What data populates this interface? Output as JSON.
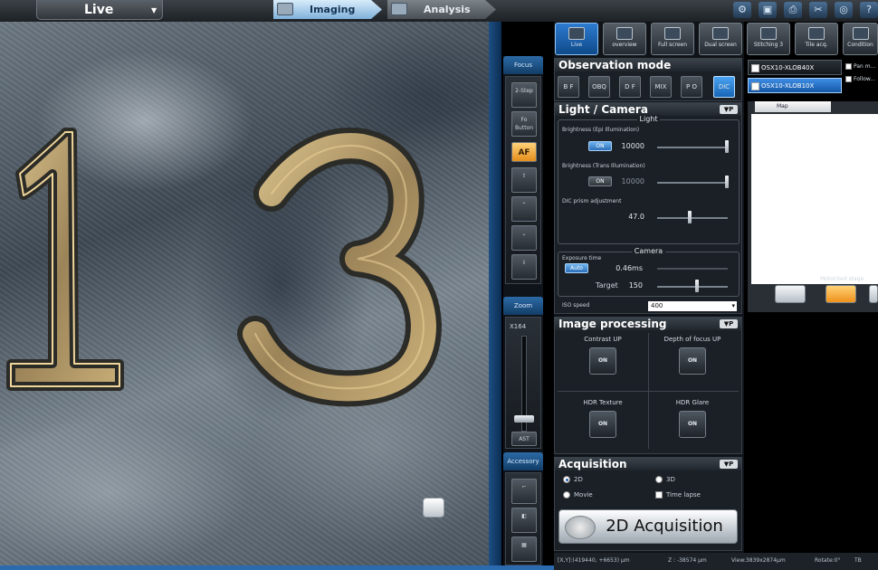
{
  "topbar": {
    "live_label": "Live",
    "tabs": [
      {
        "label": "Imaging"
      },
      {
        "label": "Analysis"
      }
    ],
    "icons": [
      "settings-icon",
      "save-icon",
      "print-icon",
      "tools-icon",
      "options-icon",
      "help-icon"
    ]
  },
  "live_image": {
    "digits": [
      "1",
      "3"
    ]
  },
  "focus_column": {
    "focus_label": "Focus",
    "buttons": [
      "2-Step",
      "Fo Button",
      "AF"
    ],
    "zoom_label": "Zoom",
    "zoom_value": "X164",
    "zoom_button": "AST",
    "accessory_label": "Accessory"
  },
  "toolbar": {
    "buttons": [
      {
        "label": "Live"
      },
      {
        "label": "overview"
      },
      {
        "label": "Full screen"
      },
      {
        "label": "Dual screen"
      },
      {
        "label": "Stitching 3"
      },
      {
        "label": "Tile acq."
      },
      {
        "label": "Condition"
      }
    ]
  },
  "observation": {
    "title": "Observation mode",
    "modes": [
      "B F",
      "OBQ",
      "D F",
      "MIX",
      "P O",
      "DIC"
    ],
    "selected": "DIC"
  },
  "light_camera": {
    "title": "Light / Camera",
    "light_group": "Light",
    "brightness_epi_label": "Brightness (Epi Illumination)",
    "brightness_epi_button": "ON",
    "brightness_epi_value": "10000",
    "brightness_trans_label": "Brightness (Trans Illumination)",
    "brightness_trans_button": "ON",
    "brightness_trans_value": "10000",
    "dic_label": "DIC prism adjustment",
    "dic_value": "47.0",
    "camera_group": "Camera",
    "exposure_label": "Exposure time",
    "exposure_button": "Auto",
    "exposure_value": "0.46ms",
    "target_label": "Target",
    "target_value": "150",
    "iso_label": "ISO speed",
    "iso_value": "400"
  },
  "image_processing": {
    "title": "Image processing",
    "items": [
      {
        "label": "Contrast UP",
        "button": "ON"
      },
      {
        "label": "Depth of focus UP",
        "button": "ON"
      },
      {
        "label": "HDR Texture",
        "button": "ON"
      },
      {
        "label": "HDR Glare",
        "button": "ON"
      }
    ]
  },
  "acquisition": {
    "title": "Acquisition",
    "options": [
      "2D",
      "3D",
      "Movie",
      "Time lapse"
    ],
    "selected": "2D",
    "button": "2D Acquisition"
  },
  "objectives": {
    "items": [
      "OSX10-XLOB40X",
      "OSX10-XLOB10X"
    ],
    "selected": "OSX10-XLOB10X",
    "checks": [
      "Pan m...",
      "Follow..."
    ]
  },
  "map": {
    "tab_label": "Map",
    "stage_label": "Motorized stage"
  },
  "statusbar": {
    "xy": "[X,Y]:(419440, +6653) μm",
    "z": "Z : -38574 μm",
    "view": "View:3839x2874μm",
    "rotate": "Rotate:0°",
    "tilt": "TB"
  }
}
